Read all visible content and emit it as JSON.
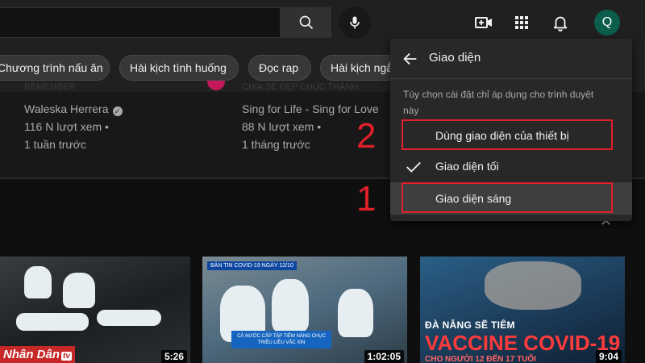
{
  "header": {
    "avatar_letter": "Q"
  },
  "chips": [
    "Chương trình nấu ăn",
    "Hài kịch tình huống",
    "Đọc rap",
    "Hài kịch ngắn"
  ],
  "previous_row": [
    {
      "channel": "Waleska Herrera",
      "views": "116 N lượt xem •",
      "age": "1 tuần trước",
      "cut_text": "REMEMBER"
    },
    {
      "channel": "Sing for Life - Sing for Love",
      "views": "88 N lượt xem •",
      "age": "1 tháng trước",
      "cut_text": "CHIA SẺ ĐẸP CHÚC THÀNH"
    }
  ],
  "appearance_menu": {
    "title": "Giao diện",
    "note": "Tùy chọn cài đặt chỉ áp dụng cho trình duyệt này",
    "options": [
      {
        "label": "Dùng giao diện của thiết bị",
        "selected": false
      },
      {
        "label": "Giao diện tối",
        "selected": true
      },
      {
        "label": "Giao diện sáng",
        "selected": false
      }
    ]
  },
  "annotations": {
    "step_1": "1",
    "step_2": "2",
    "highlight_color": "#e0202a"
  },
  "videos": [
    {
      "duration": "5:26",
      "logo_text": "Nhân Dân",
      "logo_suffix": "tv"
    },
    {
      "duration": "1:02:05",
      "tag": "BẢN TIN COVID-19 NGÀY 12/10",
      "banner": "CẢ NƯỚC CẤP TẬP TIÊM NĂNG CHỤC TRIỆU LIỀU VẮC XIN"
    },
    {
      "duration": "9:04",
      "line1": "ĐÀ NẴNG SẼ TIÊM",
      "line2": "VACCINE COVID-19",
      "line3": "CHO NGƯỜI 12 ĐẾN 17 TUỔI"
    }
  ],
  "colors": {
    "accent_red": "#e0202a",
    "avatar_bg": "#0b5e4b",
    "menu_bg": "#282828"
  }
}
